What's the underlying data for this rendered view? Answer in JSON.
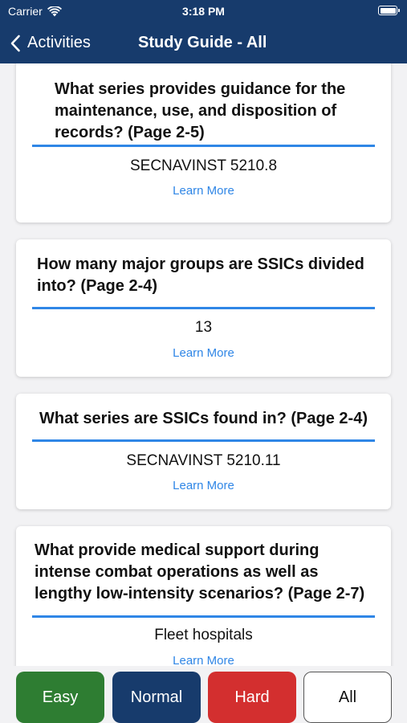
{
  "status_bar": {
    "carrier": "Carrier",
    "time": "3:18 PM"
  },
  "nav": {
    "back_label": "Activities",
    "title": "Study Guide - All"
  },
  "cards": [
    {
      "question": "What series provides guidance for the maintenance, use, and disposition of records? (Page 2-5)",
      "answer": "SECNAVINST 5210.8",
      "link": "Learn More"
    },
    {
      "question": "How many major groups are SSICs divided into? (Page 2-4)",
      "answer": "13",
      "link": "Learn More"
    },
    {
      "question": "What series are SSICs found in? (Page 2-4)",
      "answer": "SECNAVINST 5210.11",
      "link": "Learn More"
    },
    {
      "question": "What provide medical support during intense combat operations as well as lengthy low-intensity scenarios? (Page 2-7)",
      "answer": "Fleet hospitals",
      "link": "Learn More"
    }
  ],
  "filters": [
    {
      "label": "Easy",
      "color": "#2e7d32"
    },
    {
      "label": "Normal",
      "color": "#173b6c"
    },
    {
      "label": "Hard",
      "color": "#d32f2f"
    },
    {
      "label": "All",
      "color": "#ffffff"
    }
  ],
  "colors": {
    "nav_bg": "#173b6c",
    "accent": "#2f86e6"
  }
}
